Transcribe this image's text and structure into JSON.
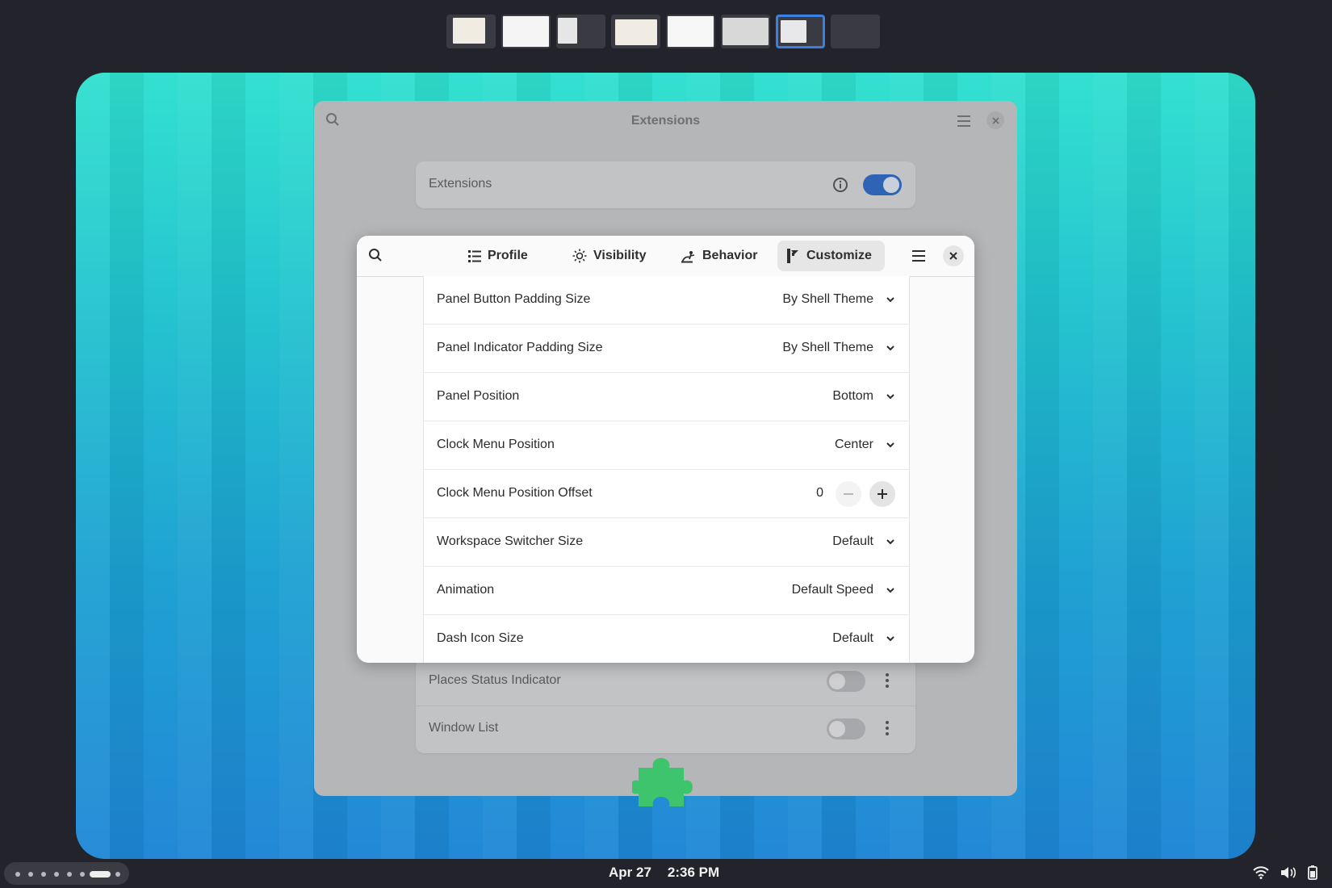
{
  "workspaces": {
    "thumbnails": [
      "workspace-1",
      "workspace-2",
      "workspace-3",
      "workspace-4",
      "workspace-5",
      "workspace-6",
      "workspace-7",
      "workspace-8"
    ],
    "active_index": 6
  },
  "background_window": {
    "title": "Extensions",
    "extensions_row": {
      "label": "Extensions",
      "enabled": true
    },
    "items": [
      {
        "label": "Places Status Indicator",
        "enabled": false
      },
      {
        "label": "Window List",
        "enabled": false
      }
    ]
  },
  "dialog": {
    "tabs": [
      {
        "label": "Profile",
        "icon": "list-icon"
      },
      {
        "label": "Visibility",
        "icon": "sun-icon"
      },
      {
        "label": "Behavior",
        "icon": "behavior-icon"
      },
      {
        "label": "Customize",
        "icon": "customize-icon",
        "active": true
      }
    ],
    "rows": [
      {
        "label": "Panel Button Padding Size",
        "value": "By Shell Theme"
      },
      {
        "label": "Panel Indicator Padding Size",
        "value": "By Shell Theme"
      },
      {
        "label": "Panel Position",
        "value": "Bottom"
      },
      {
        "label": "Clock Menu Position",
        "value": "Center"
      },
      {
        "label": "Clock Menu Position Offset",
        "value": "0"
      },
      {
        "label": "Workspace Switcher Size",
        "value": "Default"
      },
      {
        "label": "Animation",
        "value": "Default Speed"
      },
      {
        "label": "Dash Icon Size",
        "value": "Default"
      }
    ]
  },
  "top_panel": {
    "date": "Apr 27",
    "time": "2:36 PM"
  },
  "colors": {
    "accent": "#2f63b5",
    "puzzle": "#3ec46d",
    "workspace_active_border": "#3d7fe0"
  }
}
